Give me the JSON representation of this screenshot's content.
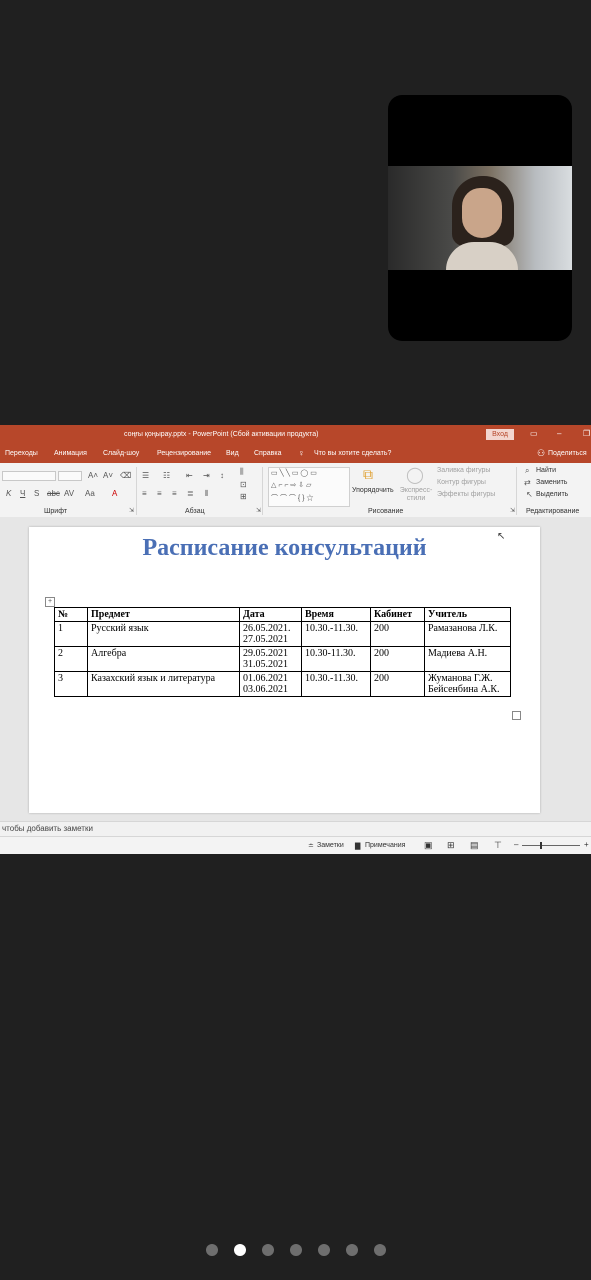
{
  "window": {
    "title": "соңғы қоңырау.pptx  -  PowerPoint (Сбой активации продукта)",
    "login_label": "Вход"
  },
  "menu": {
    "tabs": [
      "Переходы",
      "Анимация",
      "Слайд-шоу",
      "Рецензирование",
      "Вид",
      "Справка"
    ],
    "tell_me": "Что вы хотите сделать?",
    "share": "Поделиться"
  },
  "ribbon": {
    "groups": {
      "font": "Шрифт",
      "paragraph": "Абзац",
      "drawing": "Рисование",
      "editing": "Редактирование"
    },
    "arrange": "Упорядочить",
    "express_styles": "Экспресс-стили",
    "shape_fill": "Заливка фигуры",
    "shape_outline": "Контур фигуры",
    "shape_effects": "Эффекты фигуры",
    "find": "Найти",
    "replace": "Заменить",
    "select": "Выделить"
  },
  "slide": {
    "title": "Расписание консультаций",
    "table": {
      "headers": [
        "№",
        "Предмет",
        "Дата",
        "Время",
        "Кабинет",
        "Учитель"
      ],
      "rows": [
        [
          "1",
          "Русский язык",
          "26.05.2021.\n27.05.2021",
          "10.30.-11.30.",
          "200",
          "Рамазанова Л.К."
        ],
        [
          "2",
          "Алгебра",
          "29.05.2021\n31.05.2021",
          "10.30-11.30.",
          "200",
          "Мадиева А.Н."
        ],
        [
          "3",
          "Казахский язык и литература",
          "01.06.2021\n03.06.2021",
          "10.30.-11.30.",
          "200",
          "Жуманова Г.Ж.\nБейсенбина А.К."
        ]
      ]
    }
  },
  "notes_placeholder": "чтобы добавить заметки",
  "status": {
    "notes": "Заметки",
    "comments": "Примечания"
  },
  "pager": {
    "count": 7,
    "active_index": 1
  }
}
